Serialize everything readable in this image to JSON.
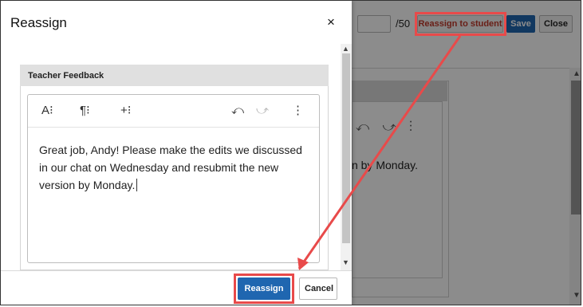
{
  "background": {
    "score_max": "/50",
    "reassign_to_student_label": "Reassign to student",
    "save_label": "Save",
    "close_label": "Close",
    "editor_tools": "⤺ ⤻ ⋮",
    "text_fragment": "n by Monday."
  },
  "modal": {
    "title": "Reassign",
    "close_icon": "×",
    "section_label": "Teacher Feedback",
    "toolbar": {
      "font_icon": "A⁝",
      "paragraph_icon": "¶⁝",
      "insert_icon": "+⁝",
      "undo_icon": "⤺",
      "redo_icon": "⤻",
      "more_icon": "⋮"
    },
    "feedback_text": "Great job, Andy! Please make the edits we discussed in our chat on Wednesday and resubmit the new version by Monday.",
    "reassign_label": "Reassign",
    "cancel_label": "Cancel"
  },
  "colors": {
    "primary": "#1f66b0",
    "annotation": "#e84a4a",
    "overlay": "rgba(0,0,0,0.45)"
  }
}
